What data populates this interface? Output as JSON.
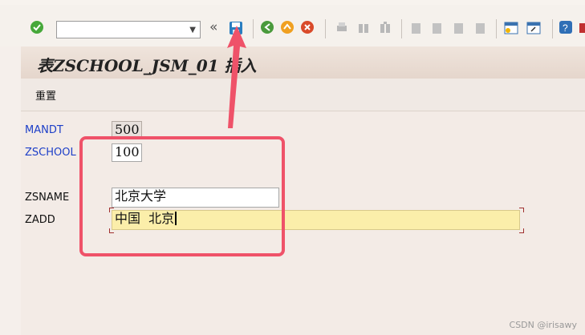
{
  "toolbar": {
    "command_field_value": "",
    "nav_label": "«",
    "icons": [
      "check-icon",
      "command-dropdown",
      "save-icon",
      "back-icon",
      "exit-icon",
      "cancel-icon",
      "print-icon",
      "find-icon",
      "find-next-icon",
      "first-page-icon",
      "prev-page-icon",
      "next-page-icon",
      "last-page-icon",
      "new-session-icon",
      "shortcut-icon",
      "help-icon",
      "layout-icon"
    ]
  },
  "header": {
    "title": "表ZSCHOOL_JSM_01 插入"
  },
  "appbar": {
    "reset_label": "重置"
  },
  "form": {
    "fields": [
      {
        "label": "MANDT",
        "value": "500"
      },
      {
        "label": "ZSCHOOL",
        "value": "100"
      },
      {
        "label": "ZSNAME",
        "value": "北京大学"
      },
      {
        "label": "ZADD",
        "value": "中国  北京"
      }
    ]
  },
  "colors": {
    "annotation": "#ef5269",
    "key_label": "#1d3fc8",
    "active_field": "#fbeeaa"
  },
  "watermark": "CSDN @irisawy"
}
